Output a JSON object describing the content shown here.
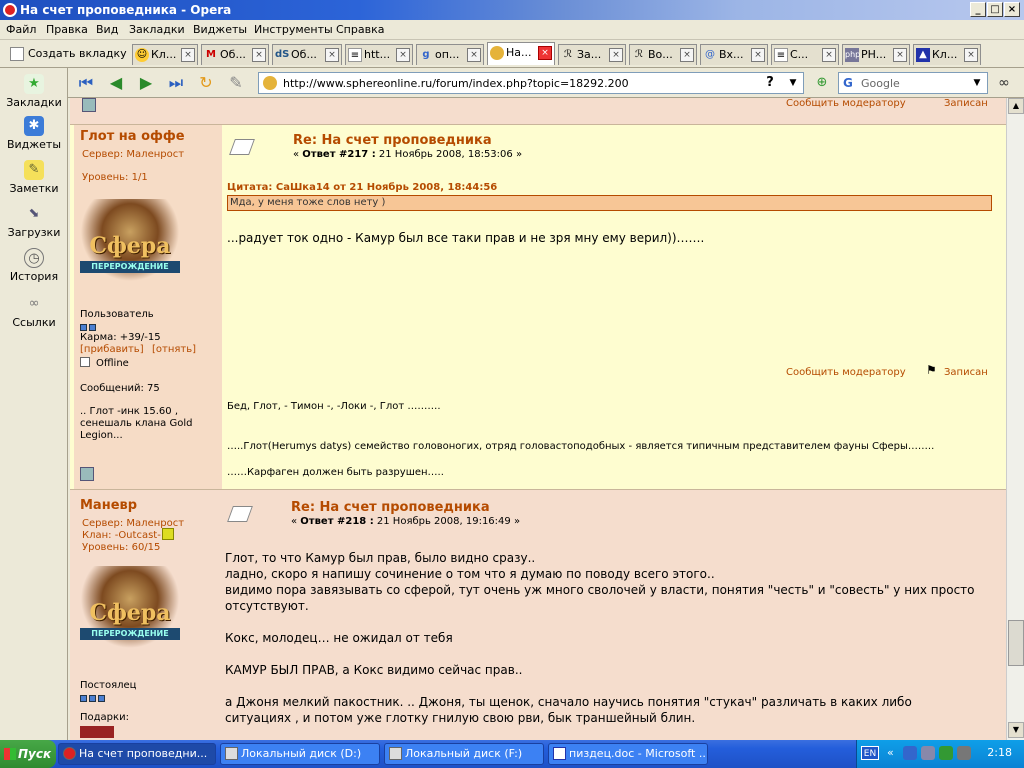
{
  "window": {
    "title": "На счет проповедника - Opera"
  },
  "menu": [
    "Файл",
    "Правка",
    "Вид",
    "Закладки",
    "Виджеты",
    "Инструменты",
    "Справка"
  ],
  "tabs": {
    "new_tab_label": "Создать вкладку",
    "items": [
      {
        "label": "Кл..."
      },
      {
        "label": "Об..."
      },
      {
        "label": "Об..."
      },
      {
        "label": "htt..."
      },
      {
        "label": "оп..."
      },
      {
        "label": "На...",
        "active": true
      },
      {
        "label": "За..."
      },
      {
        "label": "Во..."
      },
      {
        "label": "Вх..."
      },
      {
        "label": "С..."
      },
      {
        "label": "PH..."
      },
      {
        "label": "Кл..."
      }
    ]
  },
  "sidebar": [
    "Закладки",
    "Виджеты",
    "Заметки",
    "Загрузки",
    "История",
    "Ссылки"
  ],
  "address": {
    "url": "http://www.sphereonline.ru/forum/index.php?topic=18292.200",
    "search_placeholder": "Google",
    "help_glyph": "?"
  },
  "post_prev": {
    "report": "Сообщить модератору",
    "logged": "Записан"
  },
  "post1": {
    "username": "Глот на оффе",
    "server": "Сервер: Маленрост",
    "level": "Уровень: 1/1",
    "avatar_text": "Сфера",
    "avatar_sub": "ПЕРЕРОЖДЕНИЕ",
    "rank": "Пользователь",
    "karma": "Карма: +39/-15",
    "karma_add": "[прибавить]",
    "karma_sub": "[отнять]",
    "status": "Offline",
    "messages": "Сообщений: 75",
    "personal_1": ".. Глот -инк 15.60 ,",
    "personal_2": "сенешаль клана Gold",
    "personal_3": "Legion...",
    "title": "Re: На счет проповедника",
    "meta_prefix": "« ",
    "meta_reply": "Ответ #217 :",
    "meta_date": " 21 Ноябрь 2008, 18:53:06 »",
    "quote_header": "Цитата: СаШка14 от 21 Ноябрь 2008, 18:44:56",
    "quote_text": "Мда, у меня тоже слов нету )",
    "body": "...радует ток одно - Камур был все таки прав и не зря мну ему верил))…….",
    "report": "Сообщить модератору",
    "logged": "Записан",
    "sig_1": "Бед, Глот, - Тимон -, -Локи -, Глот ……….",
    "sig_2": "…..Глот(Herumys datys) семейство головоногих, отряд головастоподобных - является типичным представителем фауны Сферы……..",
    "sig_3": "……Карфаген должен быть разрушен….."
  },
  "post2": {
    "username": "Маневр",
    "server": "Сервер: Маленрост",
    "clan": "Клан: -Outcast-",
    "level": "Уровень: 60/15",
    "avatar_text": "Сфера",
    "avatar_sub": "ПЕРЕРОЖДЕНИЕ",
    "rank": "Постоялец",
    "gifts": "Подарки:",
    "title": "Re: На счет проповедника",
    "meta_prefix": "« ",
    "meta_reply": "Ответ #218 :",
    "meta_date": " 21 Ноябрь 2008, 19:16:49 »",
    "lines": [
      "Глот, то что Камур был прав, было видно сразу..",
      "ладно, скоро я напишу сочинение о том что  я думаю по поводу всего этого..",
      "видимо пора завязывать со сферой, тут очень уж много сволочей у власти, понятия \"честь\" и \"совесть\" у них просто",
      "отсутствуют.",
      "",
      "Кокс, молодец… не ожидал от тебя",
      "",
      "КАМУР БЫЛ ПРАВ,  а Кокс видимо  сейчас прав..",
      "",
      "а Джоня мелкий пакостник. ..   Джоня, ты щенок, сначало научись понятия \"стукач\" различать  в каких либо",
      "ситуациях , и потом уже глотку гнилую свою рви, бык траншейный блин."
    ]
  },
  "taskbar": {
    "start": "Пуск",
    "items": [
      {
        "label": "На счет проповедни...",
        "active": true
      },
      {
        "label": "Локальный диск (D:)"
      },
      {
        "label": "Локальный диск (F:)"
      },
      {
        "label": "пиздец.doc - Microsoft ..."
      }
    ],
    "lang": "EN",
    "clock": "2:18"
  },
  "colors": {
    "accent": "#b54b00",
    "post_bg": "#fefdd0",
    "profile_bg": "#f6dcc6",
    "quote_bg": "#f7c696"
  }
}
